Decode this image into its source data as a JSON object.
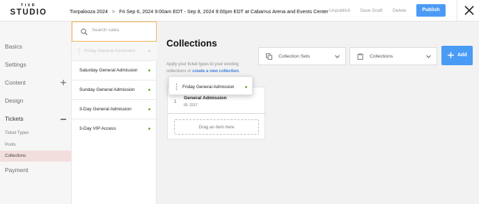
{
  "brand": {
    "line1": "TIXR",
    "line2": "STUDIO"
  },
  "header": {
    "event_name": "Tixrpalooza 2024",
    "separator": ">",
    "event_details": "Fri Sep 6, 2024 9:00am EDT - Sep 8, 2024 9:00pm EDT at Cabarrus Arena and Events Center",
    "actions": {
      "unpublish": "Unpublish",
      "save_draft": "Save Draft",
      "delete": "Delete",
      "publish": "Publish"
    }
  },
  "sidebar": {
    "items": [
      {
        "label": "Basics"
      },
      {
        "label": "Settings"
      },
      {
        "label": "Content"
      },
      {
        "label": "Design"
      },
      {
        "label": "Tickets"
      },
      {
        "label": "Payment"
      }
    ],
    "ticket_subitems": [
      {
        "label": "Ticket Types"
      },
      {
        "label": "Pools"
      },
      {
        "label": "Collections"
      }
    ]
  },
  "sales": {
    "search_placeholder": "Search sales",
    "ghost_item": "Friday General Admission",
    "items": [
      {
        "label": "Saturday General Admission"
      },
      {
        "label": "Sunday General Admission"
      },
      {
        "label": "3-Day General Admission"
      },
      {
        "label": "3-Day VIP Access"
      }
    ]
  },
  "main": {
    "title": "Collections",
    "description": "Apply your ticket types to your existing collections or",
    "description_link": "create a new collection",
    "description_end": ".",
    "dropdowns": {
      "collection_sets": "Collection Sets",
      "collections": "Collections"
    },
    "add_label": "Add",
    "card": {
      "index": "1",
      "name": "General Admission",
      "id_text": "ID: 2217",
      "drop_text": "Drag an item here"
    },
    "dragging_item": "Friday General Admission"
  },
  "colors": {
    "accent": "#4a9bf5",
    "status_dot": "#6fae3a",
    "search_focus": "#f3b34a",
    "active_nav_bg": "#f3dede"
  }
}
